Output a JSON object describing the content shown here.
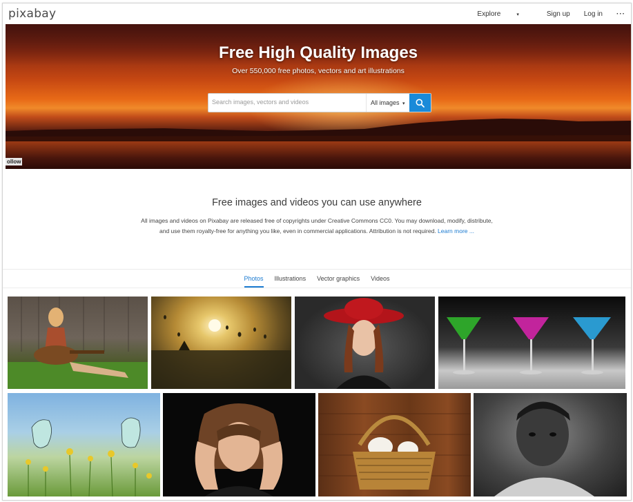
{
  "header": {
    "logo": "pixabay",
    "nav": {
      "explore": "Explore",
      "signup": "Sign up",
      "login": "Log in",
      "more": "···"
    }
  },
  "hero": {
    "title": "Free High Quality Images",
    "subtitle": "Over 550,000 free photos, vectors and art illustrations",
    "search": {
      "placeholder": "Search images, vectors and videos",
      "type_selected": "All images"
    },
    "follow_label": "ollow"
  },
  "intro": {
    "title": "Free images and videos you can use anywhere",
    "text": "All images and videos on Pixabay are released free of copyrights under Creative Commons CC0. You may download, modify, distribute, and use them royalty-free for anything you like, even in commercial applications. Attribution is not required.",
    "learn_more": "Learn more ..."
  },
  "tabs": [
    {
      "label": "Photos",
      "active": true
    },
    {
      "label": "Illustrations",
      "active": false
    },
    {
      "label": "Vector graphics",
      "active": false
    },
    {
      "label": "Videos",
      "active": false
    }
  ],
  "colors": {
    "accent": "#1a8ad9",
    "link": "#1a7ad0"
  },
  "icons": {
    "search_button": "search-icon",
    "explore_caret": "chevron-down-icon",
    "type_caret": "chevron-down-icon"
  }
}
